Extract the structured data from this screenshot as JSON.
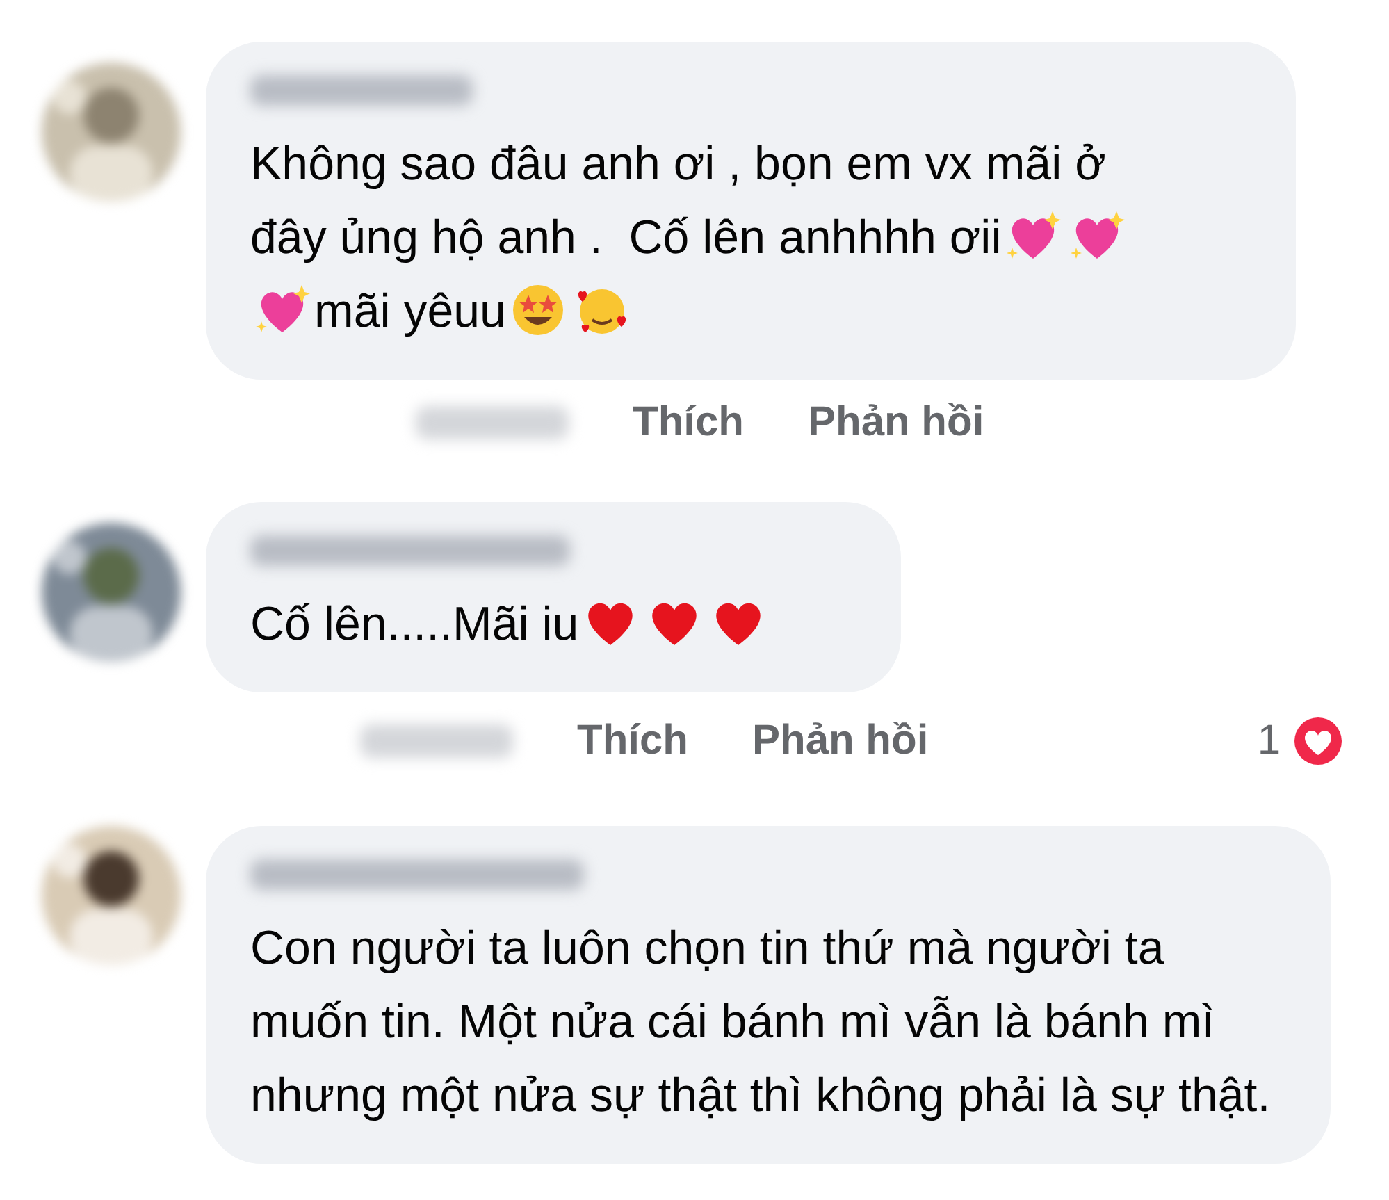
{
  "comments": [
    {
      "avatar": {
        "kind": "picture"
      },
      "body": [
        {
          "kind": "text",
          "text": "Không sao đâu anh ơi , bọn em vx mãi ở"
        },
        {
          "kind": "break"
        },
        {
          "kind": "text",
          "text": "đây ủng hộ anh .  Cố lên anhhhh ơii"
        },
        {
          "kind": "sparkle-heart"
        },
        {
          "kind": "sparkle-heart"
        },
        {
          "kind": "break"
        },
        {
          "kind": "sparkle-heart"
        },
        {
          "kind": "text",
          "text": "mãi yêuu"
        },
        {
          "kind": "star-face"
        },
        {
          "kind": "heart-face"
        }
      ],
      "actions": [
        "Thích",
        "Phản hồi"
      ]
    },
    {
      "avatar": {
        "kind": "picture"
      },
      "body": [
        {
          "kind": "text",
          "text": "Cố lên.....Mãi iu"
        },
        {
          "kind": "red-heart"
        },
        {
          "kind": "red-heart"
        },
        {
          "kind": "red-heart"
        }
      ],
      "actions": [
        "Thích",
        "Phản hồi"
      ],
      "reactions": {
        "count": "1"
      }
    },
    {
      "avatar": {
        "kind": "picture"
      },
      "body": [
        {
          "kind": "text",
          "text": "Con người ta luôn chọn tin thứ mà người ta muốn tin. Một nửa cái bánh mì vẫn là bánh mì nhưng một nửa sự thật thì không phải là sự thật."
        }
      ]
    }
  ]
}
